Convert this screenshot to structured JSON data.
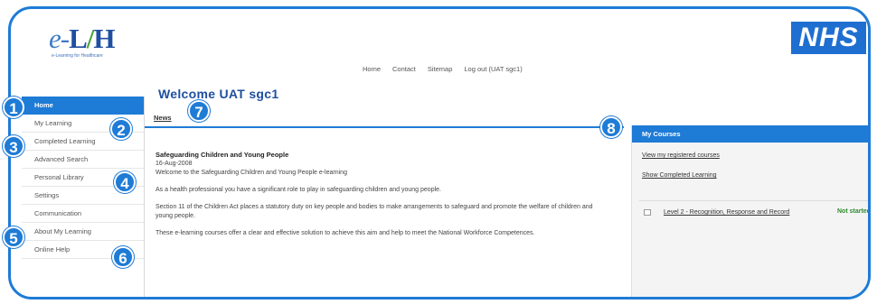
{
  "logo": {
    "main_prefix": "e-",
    "main_L": "L",
    "main_slash": "/",
    "main_H": "H",
    "tagline": "e-Learning for Healthcare"
  },
  "nhs_logo": "NHS",
  "topnav": [
    "Home",
    "Contact",
    "Sitemap",
    "Log out (UAT sgc1)"
  ],
  "sidebar": {
    "items": [
      {
        "label": "Home",
        "active": true
      },
      {
        "label": "My Learning",
        "active": false
      },
      {
        "label": "Completed Learning",
        "active": false
      },
      {
        "label": "Advanced Search",
        "active": false
      },
      {
        "label": "Personal Library",
        "active": false
      },
      {
        "label": "Settings",
        "active": false
      },
      {
        "label": "Communication",
        "active": false
      },
      {
        "label": "About My Learning",
        "active": false
      },
      {
        "label": "Online Help",
        "active": false
      }
    ]
  },
  "main": {
    "welcome": "Welcome UAT sgc1",
    "news_tab": "News",
    "article": {
      "title": "Safeguarding Children and Young People",
      "date": "16-Aug-2008",
      "intro": "Welcome to the Safeguarding Children and Young People e-learning",
      "p1": "As a health professional you have a significant role to play in safeguarding children and young people.",
      "p2": "Section 11 of the Children Act places a statutory duty on key people and bodies to make arrangements to safeguard and promote the welfare of children and young people.",
      "p3": "These e-learning courses offer a clear and effective solution to achieve this aim and help to meet the National Workforce Competences."
    }
  },
  "my_courses": {
    "title": "My Courses",
    "link_registered": "View my registered courses",
    "link_completed": "Show Completed Learning",
    "course": {
      "name": "Level 2 - Recognition, Response and Record",
      "status": "Not started"
    }
  },
  "badges": [
    "1",
    "2",
    "3",
    "4",
    "5",
    "6",
    "7",
    "8"
  ],
  "colors": {
    "accent": "#1e7bd6",
    "brand_dark": "#1f4fa0",
    "status_green": "#2e8b2e",
    "panel_bg": "#f4f4f4"
  }
}
